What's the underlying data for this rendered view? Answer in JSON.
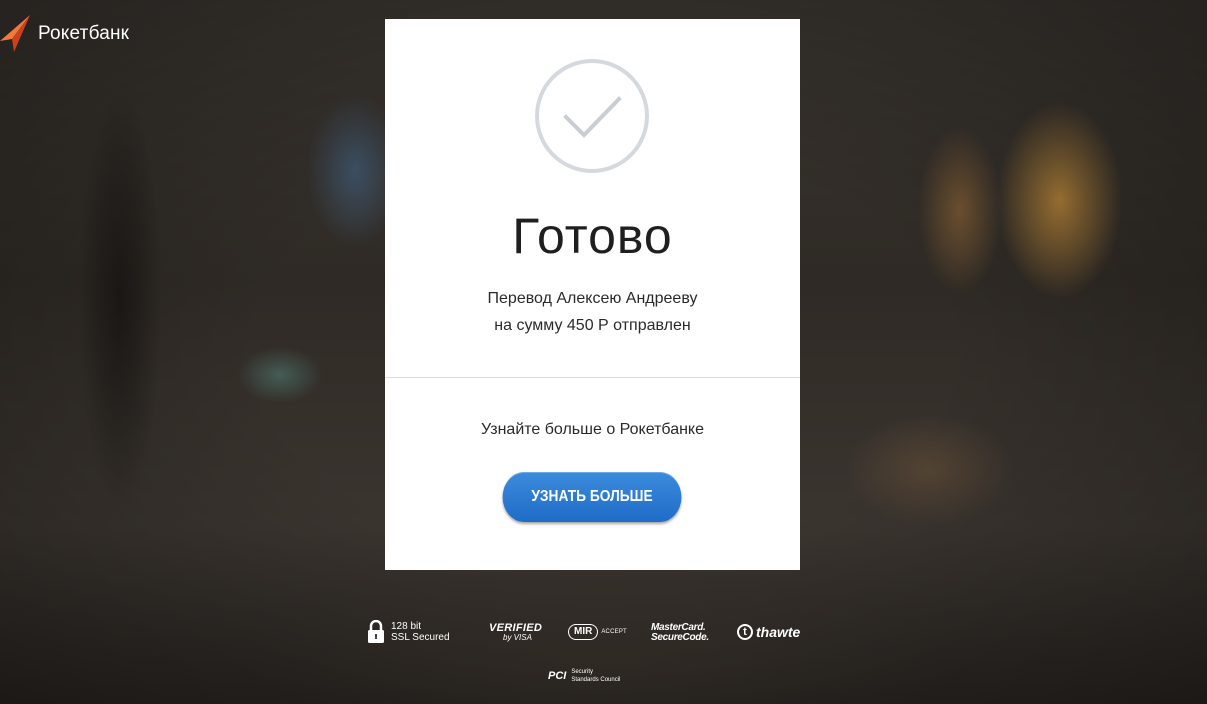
{
  "brand": {
    "name": "Рокетбанк"
  },
  "card": {
    "title": "Готово",
    "message_line1": "Перевод Алексею Андрееву",
    "message_line2": "на сумму 450 Р отправлен",
    "learn_more_text": "Узнайте больше о Рокетбанке",
    "learn_more_button": "УЗНАТЬ БОЛЬШЕ"
  },
  "badges": {
    "ssl_line1": "128 bit",
    "ssl_line2": "SSL Secured",
    "visa_line1": "VERIFIED",
    "visa_line2": "by VISA",
    "mir_label": "MIR",
    "mir_accept": "ACCEPT",
    "mastercard_line1": "MasterCard.",
    "mastercard_line2": "SecureCode.",
    "thawte_mark": "t",
    "thawte_label": "thawte",
    "pci_mark": "PCI",
    "pci_line1": "Security",
    "pci_line2": "Standards Council"
  },
  "colors": {
    "accent_button": "#1f6cc8",
    "logo_orange": "#e8552a",
    "check_circle": "#d5d9de"
  },
  "icons": [
    "rocket-logo-icon",
    "checkmark-icon",
    "lock-icon"
  ]
}
